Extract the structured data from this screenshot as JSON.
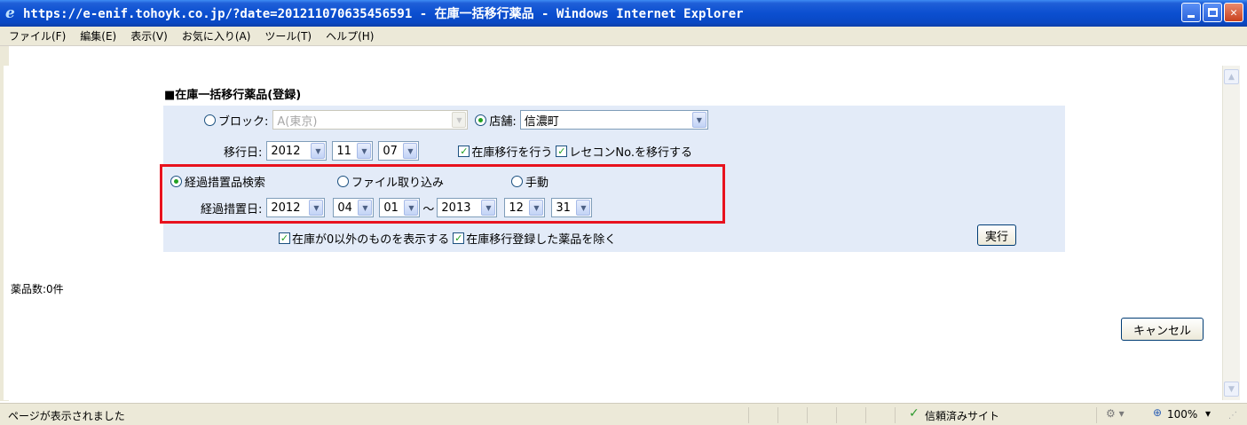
{
  "window": {
    "title": "https://e-enif.tohoyk.co.jp/?date=201211070635456591 - 在庫一括移行薬品 - Windows Internet Explorer"
  },
  "menu": [
    "ファイル(F)",
    "編集(E)",
    "表示(V)",
    "お気に入り(A)",
    "ツール(T)",
    "ヘルプ(H)"
  ],
  "form": {
    "section_title": "■在庫一括移行薬品(登録)",
    "block_label": "ブロック:",
    "block_value": "A(東京)",
    "store_label": "店舗:",
    "store_value": "信濃町",
    "transfer_date_label": "移行日:",
    "transfer_date": {
      "year": "2012",
      "month": "11",
      "day": "07"
    },
    "check_do_transfer": "在庫移行を行う",
    "check_transfer_receicon": "レセコンNo.を移行する",
    "radio_search": "経過措置品検索",
    "radio_file": "ファイル取り込み",
    "radio_manual": "手動",
    "period_label": "経過措置日:",
    "period_from": {
      "year": "2012",
      "month": "04",
      "day": "01"
    },
    "tilde": "～",
    "period_to": {
      "year": "2013",
      "month": "12",
      "day": "31"
    },
    "check_nonzero_stock": "在庫が0以外のものを表示する",
    "check_exclude_registered": "在庫移行登録した薬品を除く",
    "execute_button": "実行"
  },
  "results": {
    "count_label": "薬品数:0件"
  },
  "cancel_button": "キャンセル",
  "status": {
    "message": "ページが表示されました",
    "zone": "信頼済みサイト",
    "zoom": "100%"
  }
}
